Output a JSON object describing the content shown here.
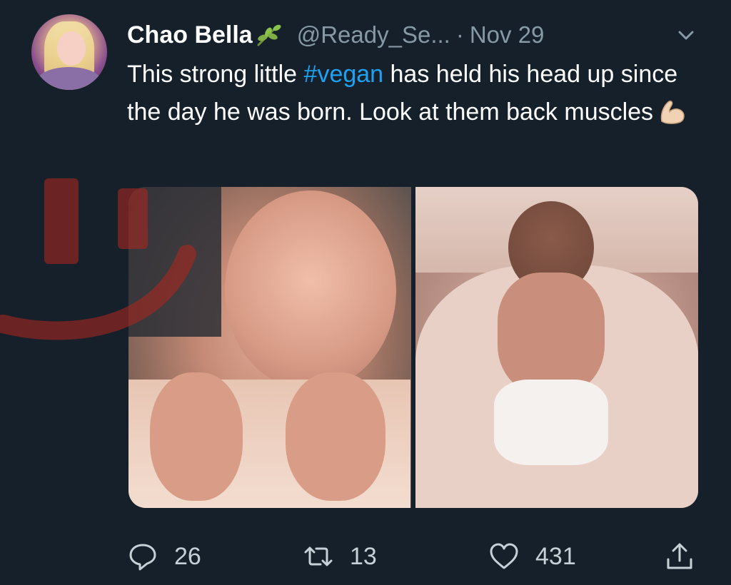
{
  "tweet": {
    "display_name": "Chao Bella",
    "handle": "@Ready_Se...",
    "separator": "·",
    "date": "Nov 29",
    "text_before": "This strong little ",
    "hashtag": "#vegan",
    "text_after": " has held his head up since the day he was born. Look at them back muscles",
    "name_emoji": "herb-icon",
    "text_emoji": "flexed-biceps-icon"
  },
  "actions": {
    "reply_count": "26",
    "retweet_count": "13",
    "like_count": "431"
  },
  "colors": {
    "background": "#15202b",
    "secondary_text": "#8899a6",
    "hashtag": "#1da1f2",
    "overlay_mark": "#b3261e"
  }
}
